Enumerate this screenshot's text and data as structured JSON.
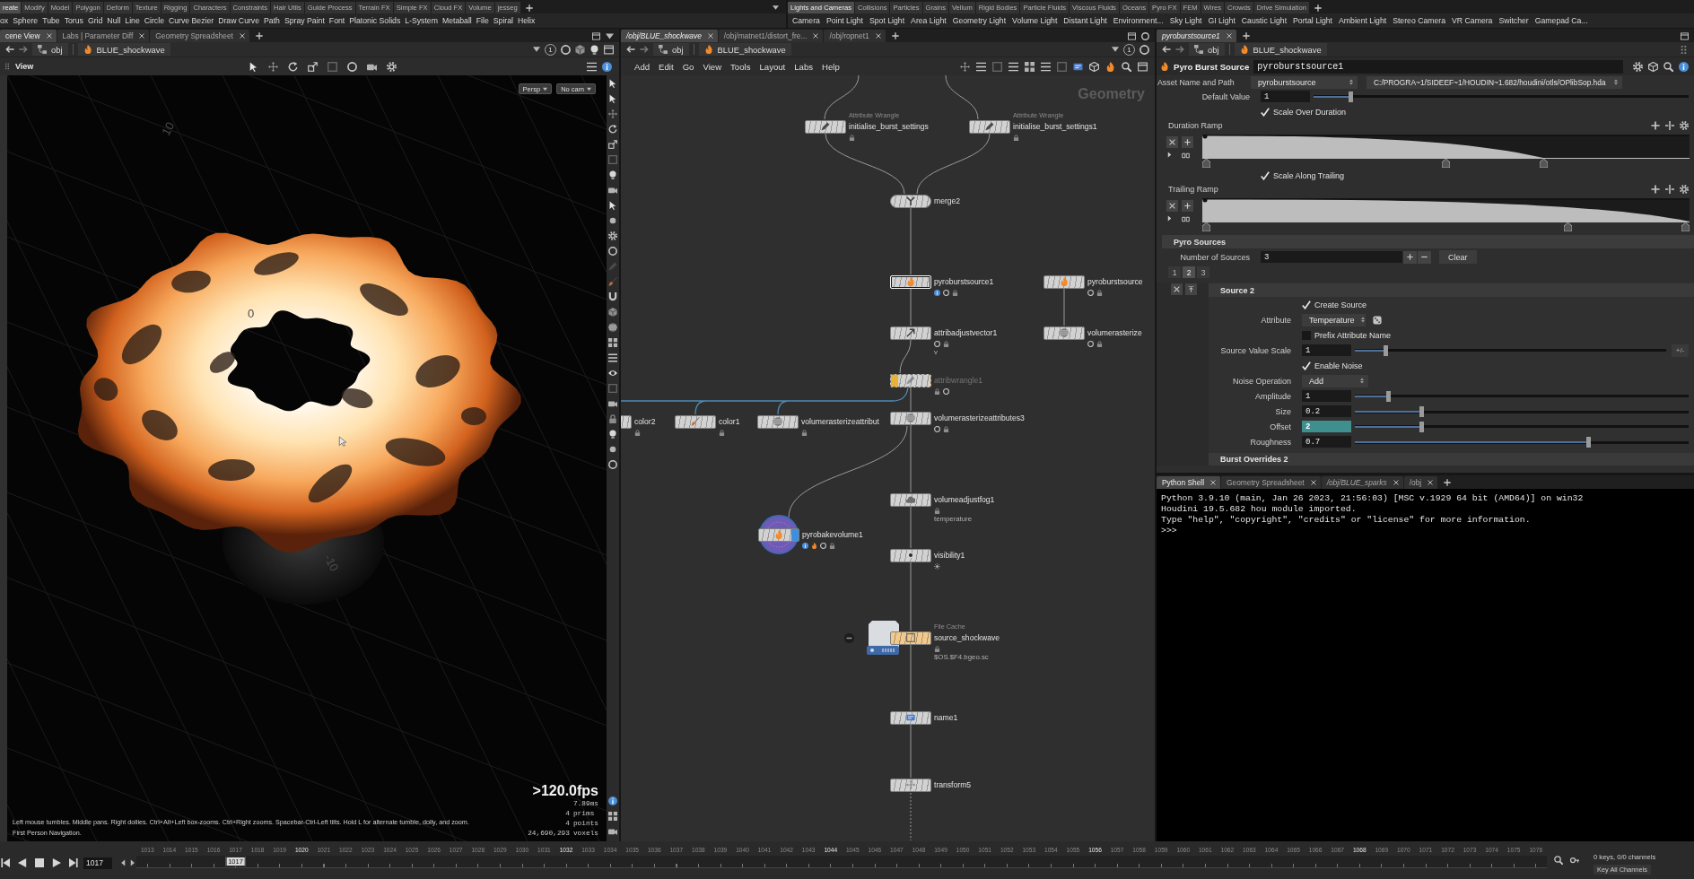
{
  "shelves": {
    "left": {
      "tabs": [
        {
          "label": "reate",
          "selected": true
        },
        {
          "label": "Modify",
          "selected": false
        },
        {
          "label": "Model",
          "selected": false
        },
        {
          "label": "Polygon",
          "selected": false
        },
        {
          "label": "Deform",
          "selected": false
        },
        {
          "label": "Texture",
          "selected": false
        },
        {
          "label": "Rigging",
          "selected": false
        },
        {
          "label": "Characters",
          "selected": false
        },
        {
          "label": "Constraints",
          "selected": false
        },
        {
          "label": "Hair Utils",
          "selected": false
        },
        {
          "label": "Guide Process",
          "selected": false
        },
        {
          "label": "Terrain FX",
          "selected": false
        },
        {
          "label": "Simple FX",
          "selected": false
        },
        {
          "label": "Cloud FX",
          "selected": false
        },
        {
          "label": "Volume",
          "selected": false
        },
        {
          "label": "jesseg",
          "selected": false
        }
      ],
      "tools": [
        "ox",
        "Sphere",
        "Tube",
        "Torus",
        "Grid",
        "Null",
        "Line",
        "Circle",
        "Curve Bezier",
        "Draw Curve",
        "Path",
        "Spray Paint",
        "Font",
        "Platonic Solids",
        "L-System",
        "Metaball",
        "File",
        "Spiral",
        "Helix"
      ]
    },
    "right": {
      "tabs": [
        {
          "label": "Lights and Cameras",
          "selected": true
        },
        {
          "label": "Collisions",
          "selected": false
        },
        {
          "label": "Particles",
          "selected": false
        },
        {
          "label": "Grains",
          "selected": false
        },
        {
          "label": "Vellum",
          "selected": false
        },
        {
          "label": "Rigid Bodies",
          "selected": false
        },
        {
          "label": "Particle Fluids",
          "selected": false
        },
        {
          "label": "Viscous Fluids",
          "selected": false
        },
        {
          "label": "Oceans",
          "selected": false
        },
        {
          "label": "Pyro FX",
          "selected": false
        },
        {
          "label": "FEM",
          "selected": false
        },
        {
          "label": "Wires",
          "selected": false
        },
        {
          "label": "Crowds",
          "selected": false
        },
        {
          "label": "Drive Simulation",
          "selected": false
        }
      ],
      "tools": [
        "Camera",
        "Point Light",
        "Spot Light",
        "Area Light",
        "Geometry Light",
        "Volume Light",
        "Distant Light",
        "Environment...",
        "Sky Light",
        "GI Light",
        "Caustic Light",
        "Portal Light",
        "Ambient Light",
        "Stereo Camera",
        "VR Camera",
        "Switcher",
        "Gamepad Ca..."
      ]
    }
  },
  "viewer": {
    "tabs": [
      {
        "label": "cene View",
        "selected": true,
        "italic": false
      },
      {
        "label": "Labs | Parameter Diff",
        "selected": false,
        "italic": false
      },
      {
        "label": "Geometry Spreadsheet",
        "selected": false,
        "italic": false
      }
    ],
    "path": [
      "obj",
      "BLUE_shockwave"
    ],
    "link_number": "1",
    "title": "View",
    "camera_menus": [
      "Persp",
      "No cam"
    ],
    "grid_labels": [
      "10",
      "0",
      "-10"
    ],
    "fps": ">120.0fps",
    "stats": [
      {
        "value": "7.89ms"
      },
      {
        "value": "4",
        "unit": "prims"
      },
      {
        "value": "4",
        "unit": "points"
      },
      {
        "value": "24,690,293",
        "unit": "voxels"
      }
    ],
    "help": [
      "Left mouse tumbles. Middle pans. Right dollies. Ctrl+Alt+Left box-zooms. Ctrl+Right zooms. Spacebar-Ctrl-Left tilts. Hold L for alternate tumble, dolly, and zoom.",
      "First Person Navigation."
    ]
  },
  "network": {
    "tabs": [
      {
        "label": "/obj/BLUE_shockwave",
        "selected": true,
        "italic": true
      },
      {
        "label": "/obj/matnet1/distort_fre...",
        "selected": false,
        "italic": false
      },
      {
        "label": "/obj/ropnet1",
        "selected": false,
        "italic": false
      }
    ],
    "path": [
      "obj",
      "BLUE_shockwave"
    ],
    "link_number": "1",
    "menu": [
      "Add",
      "Edit",
      "Go",
      "View",
      "Tools",
      "Layout",
      "Labs",
      "Help"
    ],
    "context": "Geometry",
    "nodes": [
      {
        "name": "initialise_burst_settings",
        "type_label": "Attribute Wrangle",
        "kind": "sop",
        "color": "#d2d2d2",
        "selected": false,
        "bypassed": false,
        "display_flag": false
      },
      {
        "name": "initialise_burst_settings1",
        "type_label": "Attribute Wrangle",
        "kind": "sop",
        "color": "#d2d2d2",
        "selected": false,
        "bypassed": false,
        "display_flag": false
      },
      {
        "name": "merge2",
        "kind": "merge",
        "color": "#d2d2d2",
        "selected": false,
        "bypassed": false,
        "display_flag": false
      },
      {
        "name": "pyroburstsource1",
        "kind": "sop",
        "color": "#d2d2d2",
        "selected": true,
        "bypassed": false,
        "display_flag": false
      },
      {
        "name": "pyroburstsource",
        "kind": "sop",
        "color": "#d2d2d2",
        "selected": false,
        "bypassed": false,
        "display_flag": false
      },
      {
        "name": "attribadjustvector1",
        "info": "v",
        "kind": "sop",
        "color": "#d2d2d2",
        "selected": false,
        "bypassed": false,
        "display_flag": false
      },
      {
        "name": "volumerasterize",
        "kind": "sop",
        "color": "#d2d2d2",
        "selected": false,
        "bypassed": false,
        "display_flag": false
      },
      {
        "name": "attribwrangle1",
        "kind": "sop",
        "color": "#d2d2d2",
        "selected": false,
        "bypassed": true,
        "display_flag": false
      },
      {
        "name": "color2",
        "kind": "sop",
        "color": "#d2d2d2",
        "selected": false,
        "bypassed": false,
        "display_flag": false
      },
      {
        "name": "color1",
        "kind": "sop",
        "color": "#d2d2d2",
        "selected": false,
        "bypassed": false,
        "display_flag": false
      },
      {
        "name": "volumerasterizeattribut",
        "kind": "sop",
        "color": "#d2d2d2",
        "selected": false,
        "bypassed": false,
        "display_flag": false
      },
      {
        "name": "volumerasterizeattributes3",
        "kind": "sop",
        "color": "#d2d2d2",
        "selected": false,
        "bypassed": false,
        "display_flag": false
      },
      {
        "name": "volumeadjustfog1",
        "info": "temperature",
        "kind": "sop",
        "color": "#d2d2d2",
        "selected": false,
        "bypassed": false,
        "display_flag": false
      },
      {
        "name": "pyrobakevolume1",
        "kind": "bake",
        "color": "#d2d2d2",
        "selected": false,
        "bypassed": false,
        "display_flag": true
      },
      {
        "name": "visibility1",
        "kind": "sop",
        "color": "#d2d2d2",
        "selected": false,
        "bypassed": false,
        "display_flag": false
      },
      {
        "name": "source_shockwave",
        "type_label": "File Cache",
        "info": "$OS.$F4.bgeo.sc",
        "kind": "cache",
        "color": "#f2c98c",
        "selected": false,
        "bypassed": false,
        "display_flag": false
      },
      {
        "name": "name1",
        "kind": "sop",
        "color": "#d2d2d2",
        "selected": false,
        "bypassed": false,
        "display_flag": false
      },
      {
        "name": "transform5",
        "kind": "sop",
        "color": "#d2d2d2",
        "selected": false,
        "bypassed": false,
        "display_flag": false
      }
    ]
  },
  "params": {
    "tabs": [
      {
        "label": "pyroburstsource1",
        "selected": true,
        "italic": true
      }
    ],
    "path": [
      "obj",
      "BLUE_shockwave"
    ],
    "node_type": "Pyro Burst Source",
    "node_name": "pyroburstsource1",
    "asset": {
      "label": "Asset Name and Path",
      "name": "pyroburstsource",
      "path": "C:/PROGRA~1/SIDEEF~1/HOUDIN~1.682/houdini/otls/OPlibSop.hda"
    },
    "rows": [
      {
        "kind": "slider",
        "label": "Default Value",
        "value": "1",
        "level": 0.1,
        "animated": false
      },
      {
        "kind": "checkbox",
        "label": "Scale Over Duration",
        "checked": true
      },
      {
        "kind": "ramp",
        "label": "Duration Ramp"
      },
      {
        "kind": "checkbox",
        "label": "Scale Along Trailing",
        "checked": true
      },
      {
        "kind": "ramp",
        "label": "Trailing Ramp"
      }
    ],
    "section": "Pyro Sources",
    "count": {
      "label": "Number of Sources",
      "value": "3",
      "clear": "Clear"
    },
    "instance_tabs": [
      {
        "label": "1",
        "selected": false
      },
      {
        "label": "2",
        "selected": true
      },
      {
        "label": "3",
        "selected": false
      }
    ],
    "instance": {
      "title": "Source 2",
      "rows": [
        {
          "kind": "checkbox",
          "label": "Create Source",
          "checked": true
        },
        {
          "kind": "attribute",
          "label": "Attribute",
          "value": "Temperature"
        },
        {
          "kind": "checkbox",
          "label": "Prefix Attribute Name",
          "checked": false
        },
        {
          "kind": "slider",
          "label": "Source Value Scale",
          "value": "1",
          "level": 0.1,
          "animated": false,
          "range_button": "+/-"
        },
        {
          "kind": "checkbox",
          "label": "Enable Noise",
          "checked": true
        },
        {
          "kind": "menu",
          "label": "Noise Operation",
          "value": "Add"
        },
        {
          "kind": "slider",
          "label": "Amplitude",
          "value": "1",
          "level": 0.1,
          "animated": false
        },
        {
          "kind": "slider",
          "label": "Size",
          "value": "0.2",
          "level": 0.2,
          "animated": false
        },
        {
          "kind": "slider",
          "label": "Offset",
          "value": "2",
          "level": 0.2,
          "animated": true
        },
        {
          "kind": "slider",
          "label": "Roughness",
          "value": "0.7",
          "level": 0.7,
          "animated": false
        }
      ]
    },
    "next_section": "Burst Overrides 2"
  },
  "shell": {
    "tabs": [
      {
        "label": "Python Shell",
        "selected": true,
        "italic": false
      },
      {
        "label": "Geometry Spreadsheet",
        "selected": false,
        "italic": false
      },
      {
        "label": "/obj/BLUE_sparks",
        "selected": false,
        "italic": true
      },
      {
        "label": "/obj",
        "selected": false,
        "italic": false
      }
    ],
    "lines": [
      "Python 3.9.10 (main, Jan 26 2023, 21:56:03) [MSC v.1929 64 bit (AMD64)] on win32",
      "Houdini 19.5.682 hou module imported.",
      "Type \"help\", \"copyright\", \"credits\" or \"license\" for more information.",
      ">>>"
    ]
  },
  "timeline": {
    "frame": "1017",
    "marker": "1017",
    "keys_info": "0 keys, 0/0 channels",
    "key_all": "Key All Channels",
    "frames": [
      {
        "label": "1013",
        "major": false,
        "selected": false
      },
      {
        "label": "1014",
        "major": false,
        "selected": false
      },
      {
        "label": "1015",
        "major": false,
        "selected": false
      },
      {
        "label": "1016",
        "major": false,
        "selected": false
      },
      {
        "label": "1017",
        "major": false,
        "selected": true
      },
      {
        "label": "1018",
        "major": false,
        "selected": false
      },
      {
        "label": "1019",
        "major": false,
        "selected": false
      },
      {
        "label": "1020",
        "major": true,
        "selected": false
      },
      {
        "label": "1021",
        "major": false,
        "selected": false
      },
      {
        "label": "1022",
        "major": false,
        "selected": false
      },
      {
        "label": "1023",
        "major": false,
        "selected": false
      },
      {
        "label": "1024",
        "major": false,
        "selected": false
      },
      {
        "label": "1025",
        "major": false,
        "selected": false
      },
      {
        "label": "1026",
        "major": false,
        "selected": false
      },
      {
        "label": "1027",
        "major": false,
        "selected": false
      },
      {
        "label": "1028",
        "major": false,
        "selected": false
      },
      {
        "label": "1029",
        "major": false,
        "selected": false
      },
      {
        "label": "1030",
        "major": false,
        "selected": false
      },
      {
        "label": "1031",
        "major": false,
        "selected": false
      },
      {
        "label": "1032",
        "major": true,
        "selected": false
      },
      {
        "label": "1033",
        "major": false,
        "selected": false
      },
      {
        "label": "1034",
        "major": false,
        "selected": false
      },
      {
        "label": "1035",
        "major": false,
        "selected": false
      },
      {
        "label": "1036",
        "major": false,
        "selected": false
      },
      {
        "label": "1037",
        "major": false,
        "selected": false
      },
      {
        "label": "1038",
        "major": false,
        "selected": false
      },
      {
        "label": "1039",
        "major": false,
        "selected": false
      },
      {
        "label": "1040",
        "major": false,
        "selected": false
      },
      {
        "label": "1041",
        "major": false,
        "selected": false
      },
      {
        "label": "1042",
        "major": false,
        "selected": false
      },
      {
        "label": "1043",
        "major": false,
        "selected": false
      },
      {
        "label": "1044",
        "major": true,
        "selected": false
      },
      {
        "label": "1045",
        "major": false,
        "selected": false
      },
      {
        "label": "1046",
        "major": false,
        "selected": false
      },
      {
        "label": "1047",
        "major": false,
        "selected": false
      },
      {
        "label": "1048",
        "major": false,
        "selected": false
      },
      {
        "label": "1049",
        "major": false,
        "selected": false
      },
      {
        "label": "1050",
        "major": false,
        "selected": false
      },
      {
        "label": "1051",
        "major": false,
        "selected": false
      },
      {
        "label": "1052",
        "major": false,
        "selected": false
      },
      {
        "label": "1053",
        "major": false,
        "selected": false
      },
      {
        "label": "1054",
        "major": false,
        "selected": false
      },
      {
        "label": "1055",
        "major": false,
        "selected": false
      },
      {
        "label": "1056",
        "major": true,
        "selected": false
      },
      {
        "label": "1057",
        "major": false,
        "selected": false
      },
      {
        "label": "1058",
        "major": false,
        "selected": false
      },
      {
        "label": "1059",
        "major": false,
        "selected": false
      },
      {
        "label": "1060",
        "major": false,
        "selected": false
      },
      {
        "label": "1061",
        "major": false,
        "selected": false
      },
      {
        "label": "1062",
        "major": false,
        "selected": false
      },
      {
        "label": "1063",
        "major": false,
        "selected": false
      },
      {
        "label": "1064",
        "major": false,
        "selected": false
      },
      {
        "label": "1065",
        "major": false,
        "selected": false
      },
      {
        "label": "1066",
        "major": false,
        "selected": false
      },
      {
        "label": "1067",
        "major": false,
        "selected": false
      },
      {
        "label": "1068",
        "major": true,
        "selected": false
      },
      {
        "label": "1069",
        "major": false,
        "selected": false
      },
      {
        "label": "1070",
        "major": false,
        "selected": false
      },
      {
        "label": "1071",
        "major": false,
        "selected": false
      },
      {
        "label": "1072",
        "major": false,
        "selected": false
      },
      {
        "label": "1073",
        "major": false,
        "selected": false
      },
      {
        "label": "1074",
        "major": false,
        "selected": false
      },
      {
        "label": "1075",
        "major": false,
        "selected": false
      },
      {
        "label": "1076",
        "major": false,
        "selected": false
      }
    ]
  }
}
